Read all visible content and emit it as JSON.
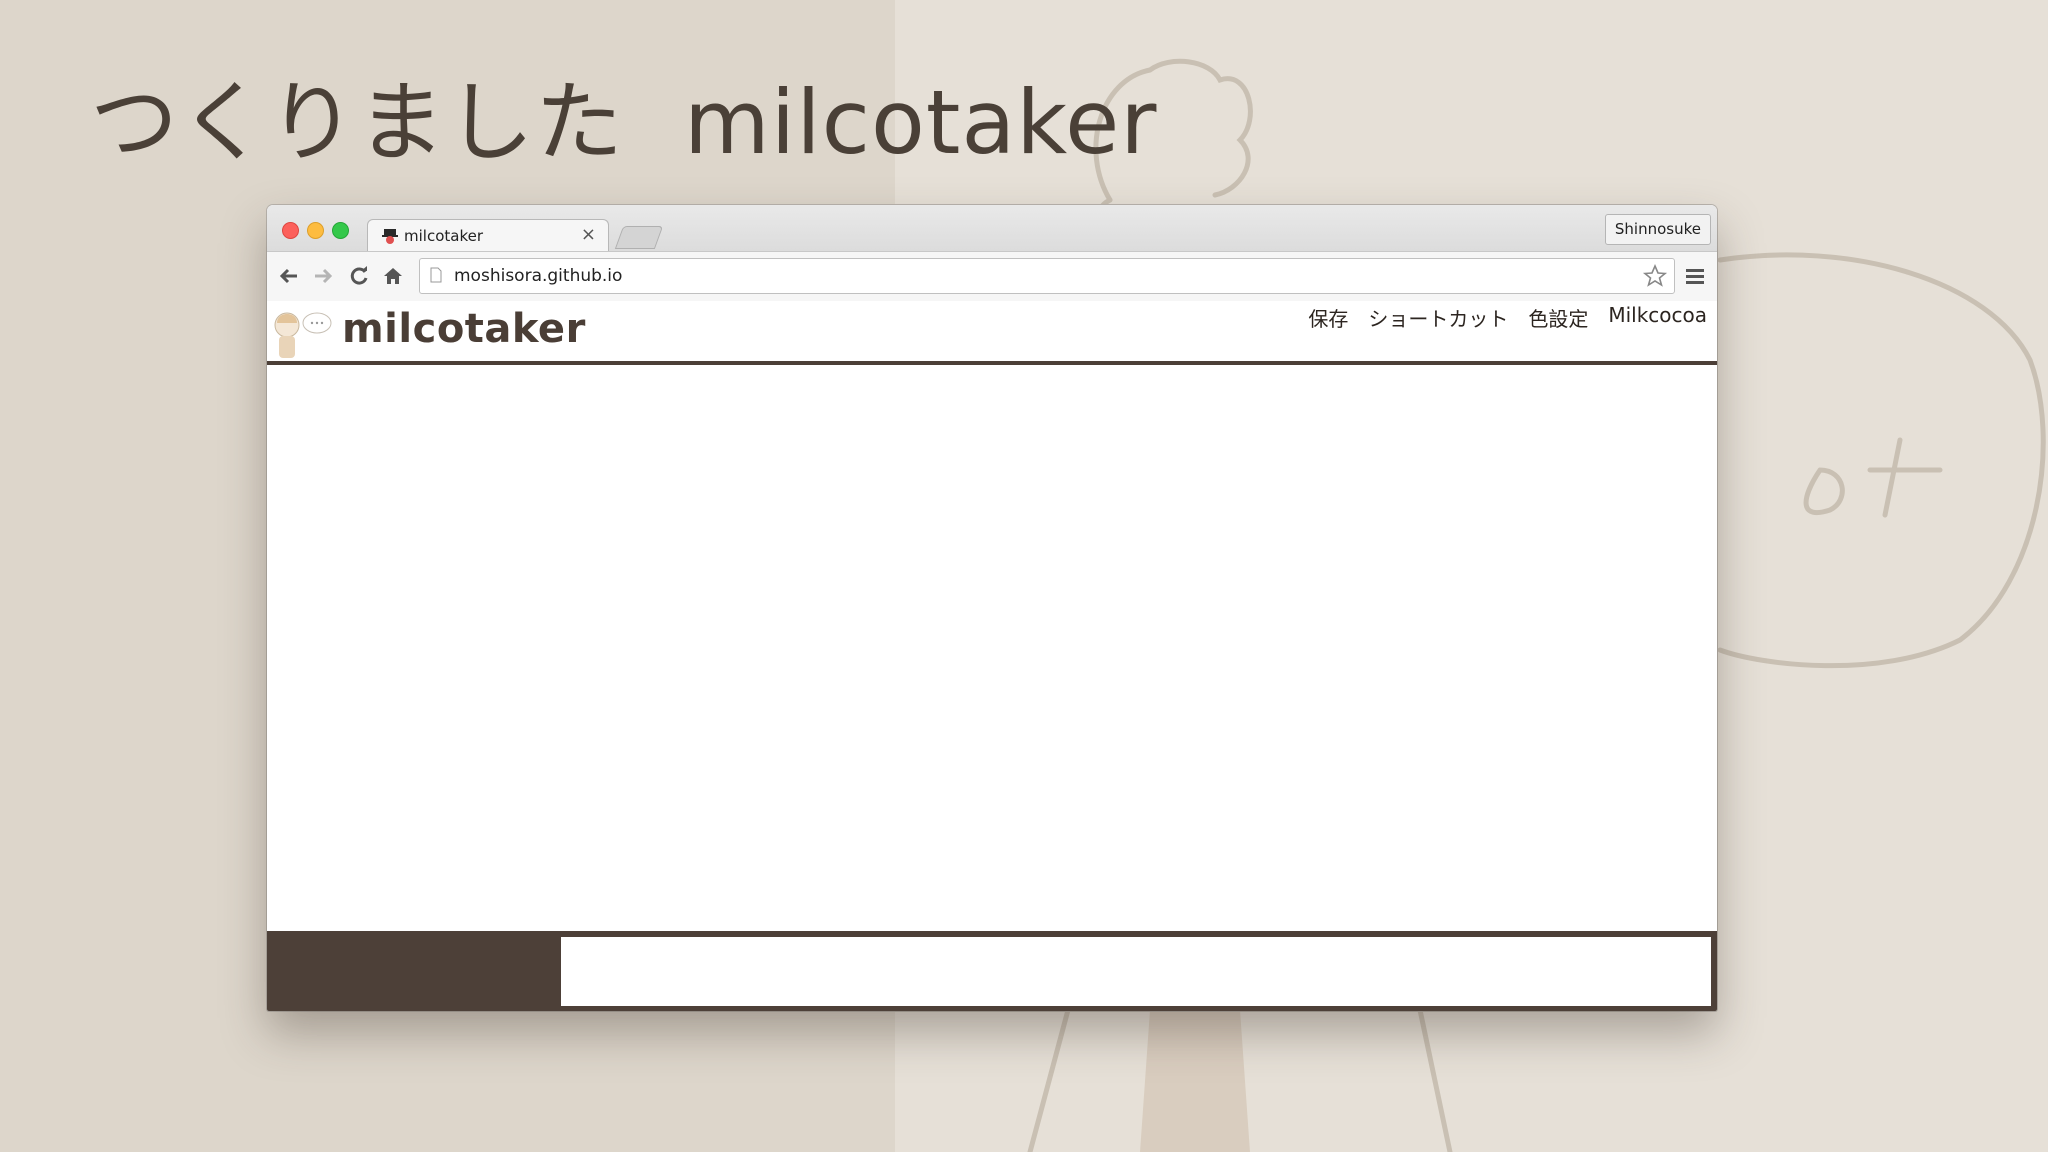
{
  "slide": {
    "title_jp": "つくりました",
    "title_app": "milcotaker"
  },
  "browser": {
    "tab_title": "milcotaker",
    "tab_close": "×",
    "profile_name": "Shinnosuke",
    "url": "moshisora.github.io"
  },
  "site": {
    "title": "milcotaker",
    "nav": [
      "保存",
      "ショートカット",
      "色設定",
      "Milkcocoa"
    ]
  },
  "footer": {
    "input_value": ""
  },
  "colors": {
    "brand_dark": "#4d4038",
    "slide_text": "#4a4037"
  }
}
